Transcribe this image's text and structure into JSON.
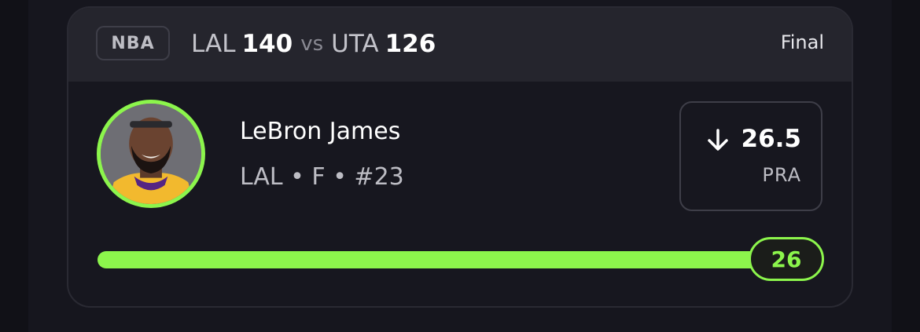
{
  "header": {
    "league": "NBA",
    "away_team": "LAL",
    "away_score": "140",
    "vs": "vs",
    "home_team": "UTA",
    "home_score": "126",
    "status": "Final"
  },
  "player": {
    "name": "LeBron James",
    "meta": "LAL • F • #23"
  },
  "projection": {
    "direction_icon": "arrow-down-icon",
    "line": "26.5",
    "stat": "PRA"
  },
  "result": {
    "value": "26",
    "progress_fraction": 0.981
  },
  "colors": {
    "accent": "#8cf54c",
    "card_bg": "#17171f",
    "header_bg": "#25252d"
  }
}
